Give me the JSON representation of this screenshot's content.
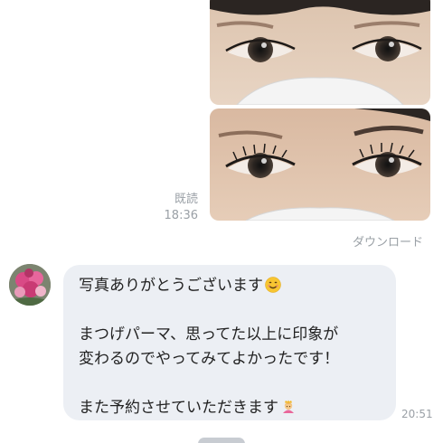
{
  "chat": {
    "photos": [
      {
        "icon": "eye-closeup-photo",
        "description_visible": false
      },
      {
        "icon": "eye-closeup-photo",
        "description_visible": false
      }
    ],
    "read_label": "既読",
    "read_time": "18:36",
    "download_label": "ダウンロード",
    "incoming": {
      "avatar_icon": "flower-bouquet-avatar",
      "line1": "写真ありがとうございます",
      "line1_emoji": "smiling-face-icon",
      "line2": "まつげパーマ、思ってた以上に印象が",
      "line3": "変わるのでやってみてよかったです！",
      "line4": "また予約させていただきます",
      "line4_emoji": "person-bowing-icon",
      "time": "20:51"
    }
  },
  "colors": {
    "bubble_bg": "#eceff4",
    "meta_text": "#9aa0a6",
    "page_bg": "#ffffff"
  }
}
